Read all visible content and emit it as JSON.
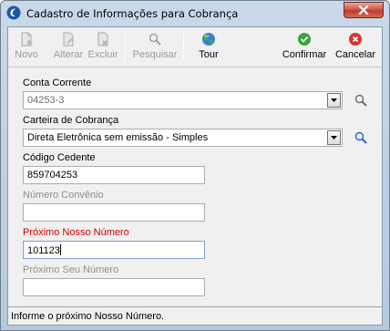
{
  "window": {
    "title": "Cadastro de Informações para Cobrança",
    "close_icon": "close-icon"
  },
  "toolbar": {
    "novo": "Novo",
    "alterar": "Alterar",
    "excluir": "Excluir",
    "pesquisar": "Pesquisar",
    "tour": "Tour",
    "confirmar": "Confirmar",
    "cancelar": "Cancelar"
  },
  "form": {
    "conta_corrente_label": "Conta Corrente",
    "conta_corrente_value": "04253-3",
    "carteira_label": "Carteira de Cobrança",
    "carteira_value": "Direta Eletrônica sem emissão - Simples",
    "codigo_cedente_label": "Código Cedente",
    "codigo_cedente_value": "859704253",
    "numero_convenio_label": "Número Convênio",
    "numero_convenio_value": "",
    "proximo_nosso_label": "Próximo Nosso Número",
    "proximo_nosso_value": "101123",
    "proximo_seu_label": "Próximo Seu Número",
    "proximo_seu_value": ""
  },
  "status": {
    "message": "Informe o próximo Nosso Número."
  }
}
